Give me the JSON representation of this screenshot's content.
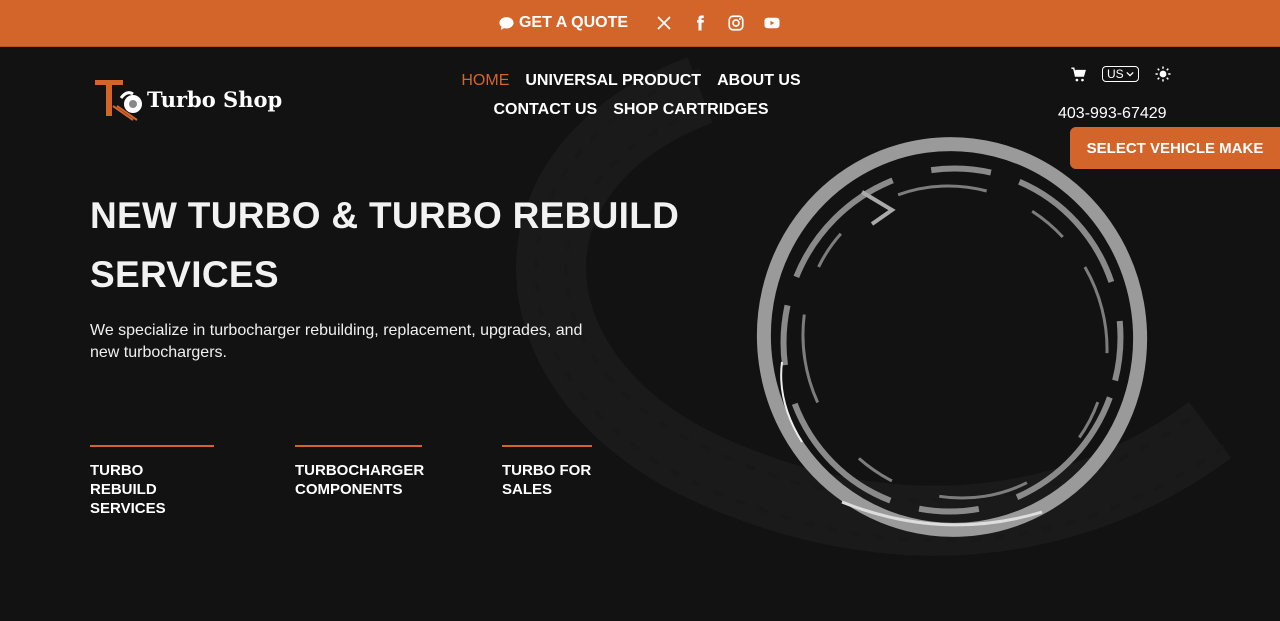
{
  "topbar": {
    "quote_label": "GET A QUOTE",
    "social": [
      {
        "icon": "x-twitter-icon"
      },
      {
        "icon": "facebook-icon"
      },
      {
        "icon": "instagram-icon"
      },
      {
        "icon": "youtube-icon"
      }
    ],
    "bg_color": "#d4652a"
  },
  "brand": {
    "name": "Turbo Shop"
  },
  "nav": {
    "items": [
      {
        "label": "HOME",
        "active": true
      },
      {
        "label": "UNIVERSAL PRODUCT"
      },
      {
        "label": "ABOUT US"
      },
      {
        "label": "CONTACT US"
      },
      {
        "label": "SHOP CARTRIDGES"
      }
    ]
  },
  "utility": {
    "cart_icon": "cart-icon",
    "language": "US",
    "theme_icon": "sun-icon",
    "phone": "403-993-67429"
  },
  "select_vehicle_label": "SELECT VEHICLE MAKE",
  "hero": {
    "title": "NEW TURBO & TURBO REBUILD SERVICES",
    "subtitle": "We specialize in turbocharger rebuilding, replacement, upgrades, and new turbochargers."
  },
  "features": [
    {
      "label": "TURBO REBUILD SERVICES"
    },
    {
      "label": "TURBOCHARGER COMPONENTS"
    },
    {
      "label": "TURBO FOR SALES"
    }
  ],
  "colors": {
    "accent": "#d4652a",
    "background": "#121212"
  }
}
